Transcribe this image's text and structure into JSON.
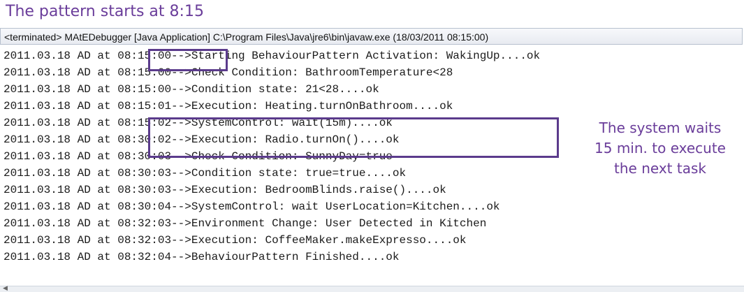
{
  "annotations": {
    "top": "The pattern starts at 8:15",
    "right_lines": [
      "The system waits",
      "15 min. to execute",
      "the next task"
    ]
  },
  "console": {
    "header": "<terminated> MAtEDebugger [Java Application] C:\\Program Files\\Java\\jre6\\bin\\javaw.exe (18/03/2011 08:15:00)",
    "lines": [
      "2011.03.18 AD at 08:15:00-->Starting BehaviourPattern Activation: WakingUp....ok",
      "2011.03.18 AD at 08:15:00-->Check Condition: BathroomTemperature<28",
      "2011.03.18 AD at 08:15:00-->Condition state: 21<28....ok",
      "2011.03.18 AD at 08:15:01-->Execution: Heating.turnOnBathroom....ok",
      "2011.03.18 AD at 08:15:02-->SystemControl: wait(15m)....ok",
      "2011.03.18 AD at 08:30:02-->Execution: Radio.turnOn()....ok",
      "2011.03.18 AD at 08:30:03-->Check Condition: SunnyDay=true",
      "2011.03.18 AD at 08:30:03-->Condition state: true=true....ok",
      "2011.03.18 AD at 08:30:03-->Execution: BedroomBlinds.raise()....ok",
      "2011.03.18 AD at 08:30:04-->SystemControl: wait UserLocation=Kitchen....ok",
      "2011.03.18 AD at 08:32:03-->Environment Change: User Detected in Kitchen",
      "2011.03.18 AD at 08:32:03-->Execution: CoffeeMaker.makeExpresso....ok",
      "2011.03.18 AD at 08:32:04-->BehaviourPattern Finished....ok"
    ]
  },
  "colors": {
    "annotation": "#6a3d9a",
    "box": "#5b3b8c"
  },
  "icons": {
    "scroll_left": "scroll-left-arrow-icon"
  }
}
